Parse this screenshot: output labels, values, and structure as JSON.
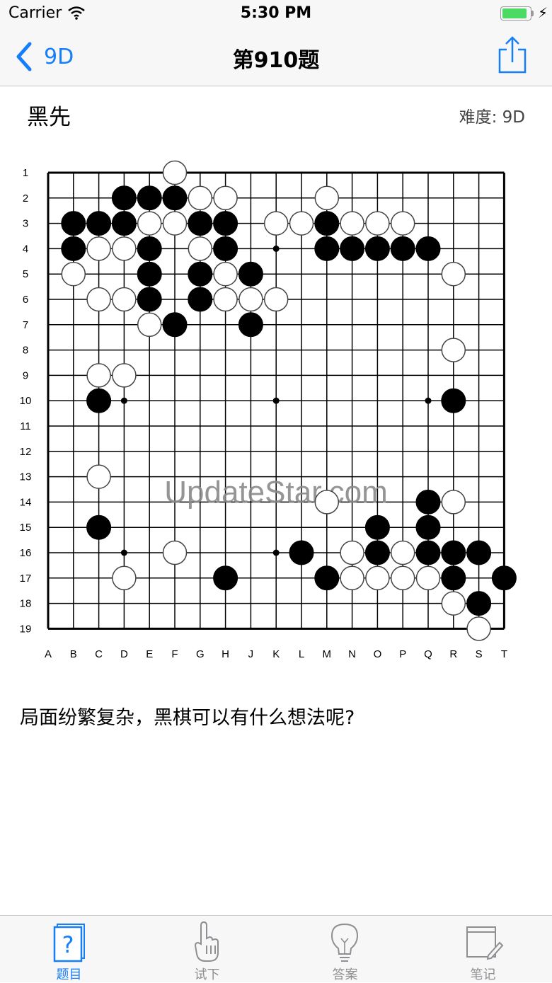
{
  "status": {
    "carrier": "Carrier",
    "time": "5:30 PM",
    "battery_level": 0.95
  },
  "nav": {
    "back_label": "9D",
    "title": "第910题"
  },
  "problem": {
    "to_play": "黑先",
    "difficulty": "难度: 9D",
    "prompt": "局面纷繁复杂，黑棋可以有什么想法呢?",
    "watermark": "UpdateStar.com"
  },
  "board": {
    "columns": [
      "A",
      "B",
      "C",
      "D",
      "E",
      "F",
      "G",
      "H",
      "J",
      "K",
      "L",
      "M",
      "N",
      "O",
      "P",
      "Q",
      "R",
      "S",
      "T"
    ],
    "rows": [
      "1",
      "2",
      "3",
      "4",
      "5",
      "6",
      "7",
      "8",
      "9",
      "10",
      "11",
      "12",
      "13",
      "14",
      "15",
      "16",
      "17",
      "18",
      "19"
    ],
    "star_points": [
      "D10",
      "K4",
      "Q10",
      "D16",
      "K10",
      "K16"
    ],
    "black_stones": [
      "D2",
      "E2",
      "F2",
      "B3",
      "C3",
      "D3",
      "G3",
      "H3",
      "M3",
      "B4",
      "E4",
      "H4",
      "M4",
      "N4",
      "O4",
      "P4",
      "Q4",
      "E5",
      "G5",
      "J5",
      "E6",
      "G6",
      "F7",
      "J7",
      "C10",
      "R10",
      "Q14",
      "C15",
      "O15",
      "Q15",
      "L16",
      "O16",
      "Q16",
      "R16",
      "S16",
      "H17",
      "M17",
      "R17",
      "T17",
      "S18"
    ],
    "white_stones": [
      "F1",
      "G2",
      "H2",
      "M2",
      "E3",
      "F3",
      "K3",
      "L3",
      "N3",
      "O3",
      "P3",
      "C4",
      "D4",
      "G4",
      "B5",
      "H5",
      "R5",
      "C6",
      "D6",
      "H6",
      "J6",
      "K6",
      "E7",
      "R8",
      "C9",
      "D9",
      "C13",
      "M14",
      "R14",
      "F16",
      "N16",
      "P16",
      "D17",
      "N17",
      "O17",
      "P17",
      "Q17",
      "R18",
      "S19"
    ]
  },
  "tabs": [
    {
      "label": "题目",
      "icon": "question-card-icon",
      "active": true
    },
    {
      "label": "试下",
      "icon": "hand-pointer-icon",
      "active": false
    },
    {
      "label": "答案",
      "icon": "lightbulb-icon",
      "active": false
    },
    {
      "label": "笔记",
      "icon": "notepad-pencil-icon",
      "active": false
    }
  ],
  "colors": {
    "accent": "#157efb",
    "inactive": "#8e8e93",
    "bar_bg": "#f7f7f7"
  }
}
